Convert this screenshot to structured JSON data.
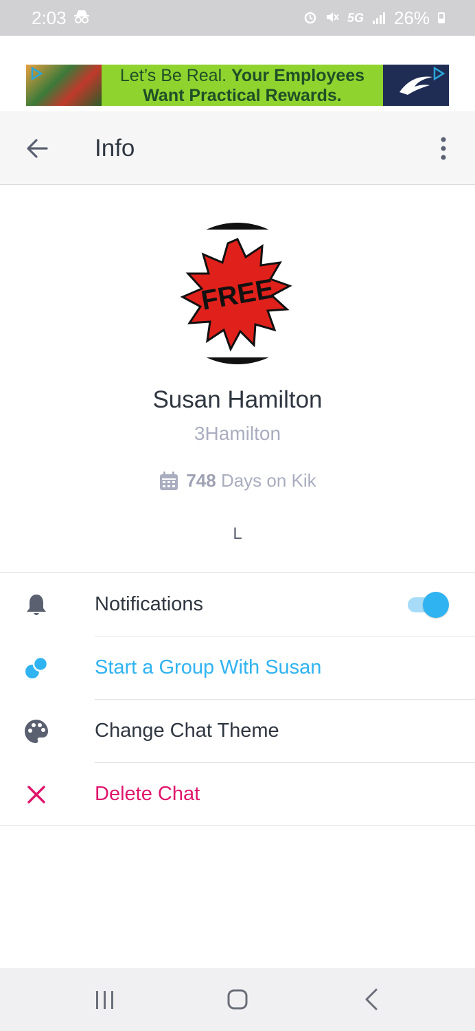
{
  "status_bar": {
    "time": "2:03",
    "network": "5G",
    "battery": "26%",
    "icons": [
      "incognito-icon",
      "alarm-icon",
      "mute-icon",
      "signal-icon",
      "battery-icon"
    ]
  },
  "ad": {
    "text_light": "Let’s Be Real.",
    "text_bold": "Your Employees Want Practical Rewards."
  },
  "header": {
    "title": "Info"
  },
  "profile": {
    "avatar_text": "FREE",
    "display_name": "Susan Hamilton",
    "username": "3Hamilton",
    "days_count": "748",
    "days_label": "Days on Kik",
    "bio": "L"
  },
  "menu": {
    "notifications": {
      "label": "Notifications",
      "enabled": true
    },
    "start_group": {
      "label": "Start a Group With Susan"
    },
    "change_theme": {
      "label": "Change Chat Theme"
    },
    "delete_chat": {
      "label": "Delete Chat"
    }
  },
  "colors": {
    "accent_blue": "#2fb3f1",
    "delete_pink": "#e0156b",
    "text_dark": "#2f3640",
    "text_muted": "#a9adbf"
  }
}
